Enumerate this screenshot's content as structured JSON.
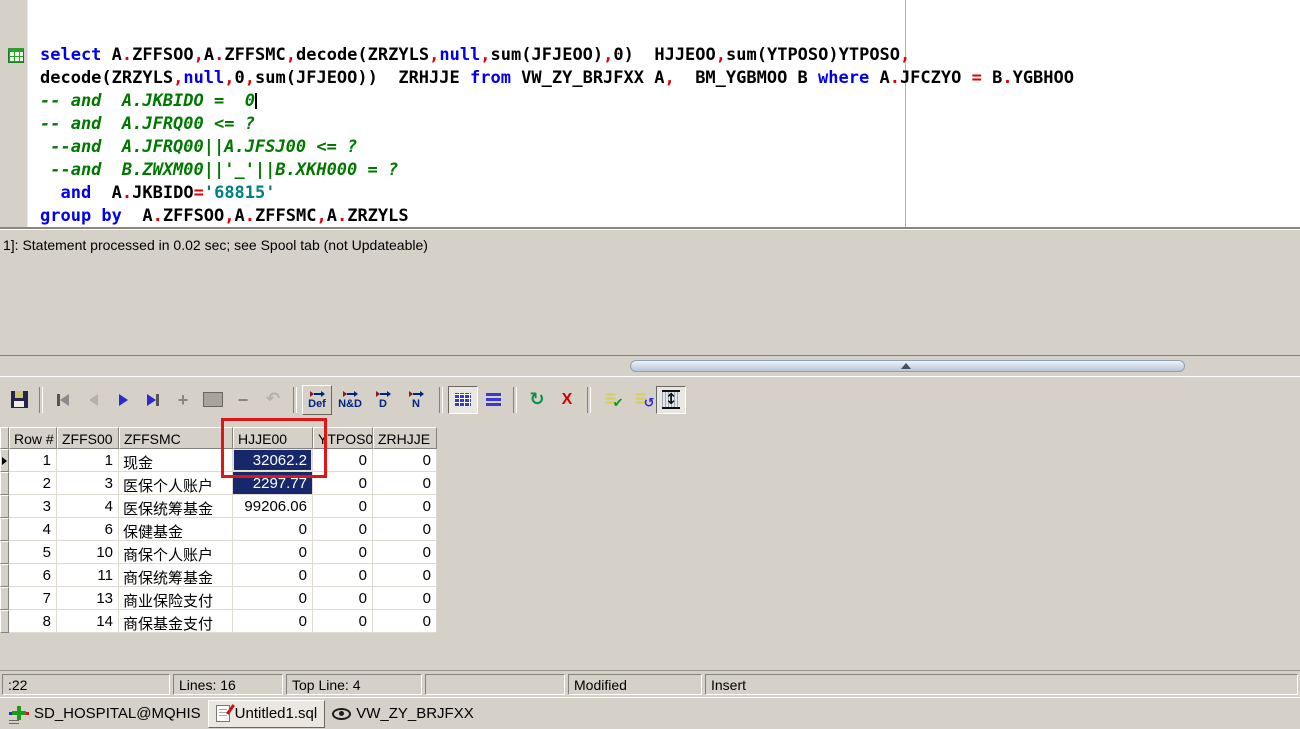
{
  "window": {
    "app": "SQL query tool"
  },
  "editor": {
    "lines": [
      [
        [
          "k",
          "select"
        ],
        [
          "i",
          " A"
        ],
        [
          "p",
          "."
        ],
        [
          "i",
          "ZFFSOO"
        ],
        [
          "p",
          ","
        ],
        [
          "i",
          "A"
        ],
        [
          "p",
          "."
        ],
        [
          "i",
          "ZFFSMC"
        ],
        [
          "p",
          ","
        ],
        [
          "f",
          "decode"
        ],
        [
          "i",
          "("
        ],
        [
          "i",
          "ZRZYLS"
        ],
        [
          "p",
          ","
        ],
        [
          "k",
          "null"
        ],
        [
          "p",
          ","
        ],
        [
          "f",
          "sum"
        ],
        [
          "i",
          "(JFJEOO)"
        ],
        [
          "p",
          ","
        ],
        [
          "i",
          "0)  HJJEOO"
        ],
        [
          "p",
          ","
        ],
        [
          "f",
          "sum"
        ],
        [
          "i",
          "(YTPOSO)YTPOSO"
        ],
        [
          "p",
          ","
        ]
      ],
      [
        [
          "f",
          "decode"
        ],
        [
          "i",
          "(ZRZYLS"
        ],
        [
          "p",
          ","
        ],
        [
          "k",
          "null"
        ],
        [
          "p",
          ","
        ],
        [
          "i",
          "0"
        ],
        [
          "p",
          ","
        ],
        [
          "f",
          "sum"
        ],
        [
          "i",
          "(JFJEOO))  ZRHJJE "
        ],
        [
          "k",
          "from"
        ],
        [
          "i",
          " VW_ZY_BRJFXX A"
        ],
        [
          "p",
          ","
        ],
        [
          "i",
          "  BM_YGBMOO B "
        ],
        [
          "k",
          "where"
        ],
        [
          "i",
          " A"
        ],
        [
          "p",
          "."
        ],
        [
          "i",
          "JFCZYO "
        ],
        [
          "p",
          "="
        ],
        [
          "i",
          " B"
        ],
        [
          "p",
          "."
        ],
        [
          "i",
          "YGBHOO"
        ]
      ],
      [
        [
          "c",
          "-- and  A.JKBIDO =  0"
        ],
        [
          "caret",
          ""
        ]
      ],
      [
        [
          "c",
          "-- and  A.JFRQ00 <= ?"
        ]
      ],
      [
        [
          "c",
          " --and  A.JFRQ00||A.JFSJ00 <= ?"
        ]
      ],
      [
        [
          "c",
          " --and  B.ZWXM00||'_'||B.XKH000 = ?"
        ]
      ],
      [
        [
          "i",
          "  "
        ],
        [
          "k",
          "and"
        ],
        [
          "i",
          "  A"
        ],
        [
          "p",
          "."
        ],
        [
          "i",
          "JKBIDO"
        ],
        [
          "p",
          "="
        ],
        [
          "s",
          "'68815'"
        ]
      ],
      [
        [
          "k",
          "group by"
        ],
        [
          "i",
          "  A"
        ],
        [
          "p",
          "."
        ],
        [
          "i",
          "ZFFSOO"
        ],
        [
          "p",
          ","
        ],
        [
          "i",
          "A"
        ],
        [
          "p",
          "."
        ],
        [
          "i",
          "ZFFSMC"
        ],
        [
          "p",
          ","
        ],
        [
          "i",
          "A"
        ],
        [
          "p",
          "."
        ],
        [
          "i",
          "ZRZYLS"
        ]
      ]
    ]
  },
  "message": {
    "text": "1]: Statement processed in 0.02 sec; see Spool tab (not Updateable)"
  },
  "toolbar": {
    "def_label": "Def",
    "nd_label": "N&D",
    "d_label": "D",
    "n_label": "N"
  },
  "grid": {
    "headers": [
      "Row #",
      "ZFFS00",
      "ZFFSMC",
      "HJJE00",
      "YTPOS0",
      "ZRHJJE"
    ],
    "rows": [
      {
        "cells": [
          "1",
          "1",
          "现金",
          "32062.2",
          "0",
          "0"
        ],
        "hjje": "focused",
        "current": true
      },
      {
        "cells": [
          "2",
          "3",
          "医保个人账户",
          "2297.77",
          "0",
          "0"
        ],
        "hjje": "selected"
      },
      {
        "cells": [
          "3",
          "4",
          "医保统筹基金",
          "99206.06",
          "0",
          "0"
        ]
      },
      {
        "cells": [
          "4",
          "6",
          "保健基金",
          "0",
          "0",
          "0"
        ]
      },
      {
        "cells": [
          "5",
          "10",
          "商保个人账户",
          "0",
          "0",
          "0"
        ]
      },
      {
        "cells": [
          "6",
          "11",
          "商保统筹基金",
          "0",
          "0",
          "0"
        ]
      },
      {
        "cells": [
          "7",
          "13",
          "商业保险支付",
          "0",
          "0",
          "0"
        ]
      },
      {
        "cells": [
          "8",
          "14",
          "商保基金支付",
          "0",
          "0",
          "0"
        ]
      }
    ]
  },
  "status": {
    "cursor": ":22",
    "lines": "Lines: 16",
    "top_line": "Top Line: 4",
    "empty": "",
    "modified": "Modified",
    "insert_mode": "Insert"
  },
  "tabs": [
    {
      "label": "SD_HOSPITAL@MQHIS",
      "icon": "connection-icon",
      "active": false
    },
    {
      "label": "Untitled1.sql",
      "icon": "document-icon",
      "active": true
    },
    {
      "label": "VW_ZY_BRJFXX",
      "icon": "view-eye-icon",
      "active": false
    }
  ],
  "icons": {
    "statement-marker": "green-table-grid",
    "save": "floppy-disk",
    "first-record": "bar-left-triangle",
    "prior-record": "left-triangle",
    "next-record": "right-triangle-blue",
    "last-record": "right-triangle-bar",
    "insert-record": "plus",
    "post-edit": "gray-square",
    "delete-record": "minus",
    "undo": "curved-left-arrow",
    "grid-view": "blue-table-grid",
    "form-view": "blue-form-rows",
    "refresh": "green-circular-arrows",
    "cancel": "red-x",
    "commit": "disks-green-check",
    "rollback": "disks-blue-arrow",
    "fit-columns": "table-updown-arrows",
    "collapse-splitter": "chevron-up",
    "connection": "green-cross-connector",
    "document": "page-with-red-pen",
    "view": "eye"
  },
  "colors": {
    "window_bg": "#d5d1c8",
    "keyword": "#0000ee",
    "comment": "#007800",
    "string": "#008080",
    "punctuation": "#e00000",
    "selection_bg": "#16276c",
    "annotation_red": "#e01515"
  }
}
